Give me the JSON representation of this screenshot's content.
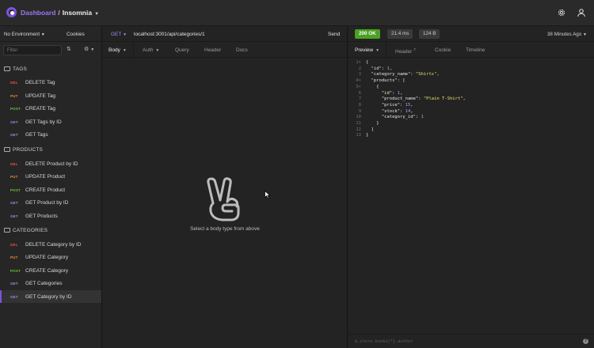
{
  "app": {
    "breadcrumb_dashboard": "Dashboard",
    "breadcrumb_separator": "/",
    "breadcrumb_workspace": "Insomnia",
    "brand_color": "#7d52e0"
  },
  "sidebar": {
    "environment": "No Environment",
    "cookies": "Cookies",
    "filter_placeholder": "Filter",
    "folders": [
      {
        "name": "TAGS",
        "items": [
          {
            "method": "DEL",
            "label": "DELETE Tag"
          },
          {
            "method": "PUT",
            "label": "UPDATE Tag"
          },
          {
            "method": "POST",
            "label": "CREATE Tag"
          },
          {
            "method": "GET",
            "label": "GET Tags by ID"
          },
          {
            "method": "GET",
            "label": "GET Tags"
          }
        ]
      },
      {
        "name": "PRODUCTS",
        "items": [
          {
            "method": "DEL",
            "label": "DELETE Product by ID"
          },
          {
            "method": "PUT",
            "label": "UPDATE Product"
          },
          {
            "method": "POST",
            "label": "CREATE Product"
          },
          {
            "method": "GET",
            "label": "GET Product by ID"
          },
          {
            "method": "GET",
            "label": "GET Products"
          }
        ]
      },
      {
        "name": "CATEGORIES",
        "items": [
          {
            "method": "DEL",
            "label": "DELETE Category by ID"
          },
          {
            "method": "PUT",
            "label": "UPDATE Category"
          },
          {
            "method": "POST",
            "label": "CREATE Category"
          },
          {
            "method": "GET",
            "label": "GET Categories"
          },
          {
            "method": "GET",
            "label": "GET Category by ID"
          }
        ]
      }
    ],
    "method_colors": {
      "DEL": "#e5533a",
      "PUT": "#e58b27",
      "POST": "#6fbf3a",
      "GET": "#9e87f0"
    }
  },
  "request": {
    "method": "GET",
    "url": "localhost:3001/api/categories/1",
    "send": "Send",
    "tabs": [
      "Body",
      "Auth",
      "Query",
      "Header",
      "Docs"
    ],
    "empty_message": "Select a body type from above"
  },
  "response": {
    "status": "200 OK",
    "time": "21.4 ms",
    "size": "124 B",
    "age": "38 Minutes Ago",
    "tabs": [
      "Preview",
      "Header",
      "Cookie",
      "Timeline"
    ],
    "header_count": "7",
    "filter_placeholder": "$.store.books[*].author",
    "help": "?",
    "status_color": "#4aa123",
    "body_lines": [
      "{",
      "  \"id\": 1,",
      "  \"category_name\": \"Shirts\",",
      "  \"products\": [",
      "    {",
      "      \"id\": 1,",
      "      \"product_name\": \"Plain T-Shirt\",",
      "      \"price\": 15,",
      "      \"stock\": 14,",
      "      \"category_id\": 1",
      "    }",
      "  ]",
      "}"
    ]
  }
}
